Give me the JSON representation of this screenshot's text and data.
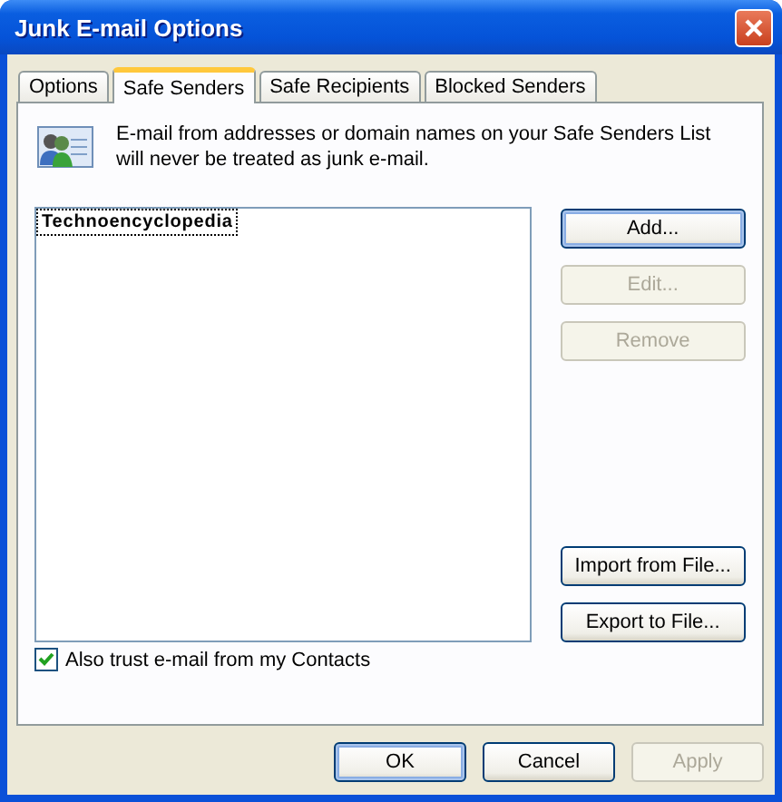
{
  "window": {
    "title": "Junk E-mail Options"
  },
  "tabs": [
    {
      "label": "Options",
      "selected": false
    },
    {
      "label": "Safe Senders",
      "selected": true
    },
    {
      "label": "Safe Recipients",
      "selected": false
    },
    {
      "label": "Blocked Senders",
      "selected": false
    }
  ],
  "description": "E-mail from addresses or domain names on your Safe Senders List will never be treated as junk e-mail.",
  "safe_senders": [
    {
      "text": "Technoencyclopedia",
      "focused": true
    }
  ],
  "list_buttons": [
    {
      "label": "Add...",
      "disabled": false,
      "default": true
    },
    {
      "label": "Edit...",
      "disabled": true,
      "default": false
    },
    {
      "label": "Remove",
      "disabled": true,
      "default": false
    }
  ],
  "file_buttons": [
    {
      "label": "Import from File...",
      "disabled": false,
      "default": false
    },
    {
      "label": "Export to File...",
      "disabled": false,
      "default": false
    }
  ],
  "also_trust_contacts": {
    "label": "Also trust e-mail from my Contacts",
    "checked": true
  },
  "dialog_buttons": [
    {
      "label": "OK",
      "disabled": false,
      "default": true
    },
    {
      "label": "Cancel",
      "disabled": false,
      "default": false
    },
    {
      "label": "Apply",
      "disabled": true,
      "default": false
    }
  ]
}
